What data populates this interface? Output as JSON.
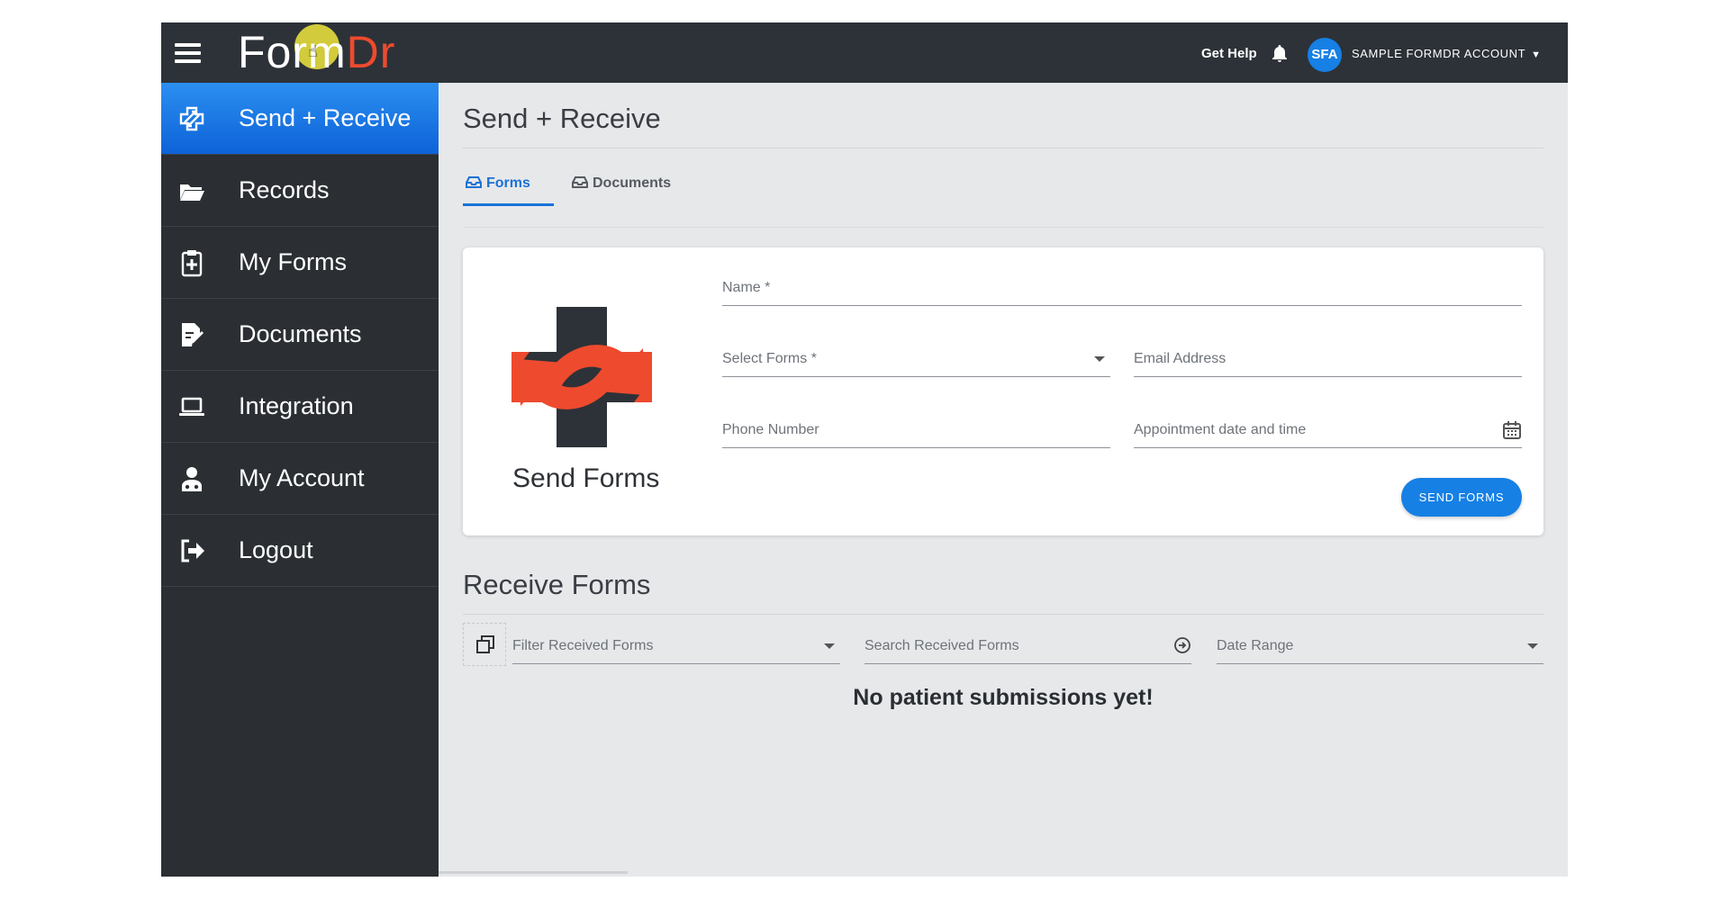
{
  "topbar": {
    "logo_part1": "Form",
    "logo_part2": "Dr",
    "get_help": "Get Help",
    "avatar_initials": "SFA",
    "account_name": "SAMPLE FORMDR ACCOUNT",
    "account_caret": "▼"
  },
  "sidebar": {
    "items": [
      {
        "label": "Send + Receive",
        "icon": "send-receive-icon",
        "active": true
      },
      {
        "label": "Records",
        "icon": "folder-icon"
      },
      {
        "label": "My Forms",
        "icon": "clipboard-plus-icon"
      },
      {
        "label": "Documents",
        "icon": "document-edit-icon"
      },
      {
        "label": "Integration",
        "icon": "laptop-icon"
      },
      {
        "label": "My Account",
        "icon": "doctor-icon"
      },
      {
        "label": "Logout",
        "icon": "logout-icon"
      }
    ]
  },
  "main": {
    "page_title": "Send + Receive",
    "tabs": [
      {
        "label": "Forms",
        "active": true
      },
      {
        "label": "Documents"
      }
    ],
    "send_card": {
      "title": "Send Forms",
      "name_placeholder": "Name *",
      "select_forms_placeholder": "Select Forms *",
      "email_placeholder": "Email Address",
      "phone_placeholder": "Phone Number",
      "appointment_placeholder": "Appointment date and time",
      "send_button": "SEND FORMS"
    },
    "receive": {
      "title": "Receive Forms",
      "filter_placeholder": "Filter Received Forms",
      "search_placeholder": "Search Received Forms",
      "date_range_placeholder": "Date Range",
      "empty_message": "No patient submissions yet!"
    }
  },
  "colors": {
    "topbar": "#2d3238",
    "sidebar": "#2b2f34",
    "accent_blue": "#1680e5",
    "logo_red": "#ee4a2e",
    "content_bg": "#e7e8ea"
  }
}
